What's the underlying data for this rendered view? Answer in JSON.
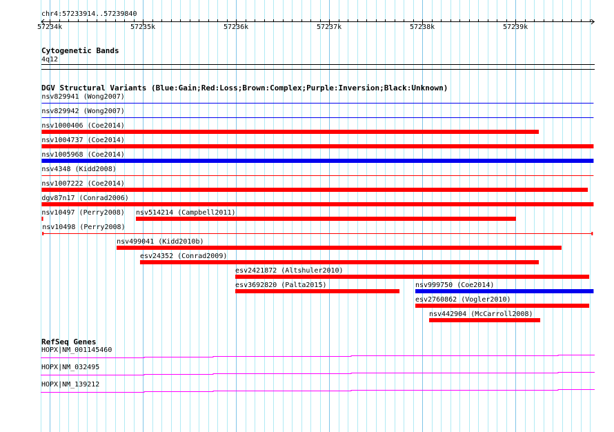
{
  "location": "chr4:57233914..57239840",
  "view": {
    "start": 57233914,
    "end": 57239840
  },
  "ruler": {
    "ticks": [
      "57234k",
      "57235k",
      "57236k",
      "57237k",
      "57238k",
      "57239k"
    ],
    "tick_values": [
      57234000,
      57235000,
      57236000,
      57237000,
      57238000,
      57239000
    ]
  },
  "cyto": {
    "title": "Cytogenetic Bands",
    "band": "4q12"
  },
  "dgv": {
    "title": "DGV Structural Variants (Blue:Gain;Red:Loss;Brown:Complex;Purple:Inversion;Black:Unknown)",
    "colors": {
      "gain": "#0000ee",
      "loss": "#ff0000"
    },
    "rows": [
      [
        {
          "label": "nsv829941 (Wong2007)",
          "start": 57233914,
          "end": 57239840,
          "type": "gain",
          "thin": true
        }
      ],
      [
        {
          "label": "nsv829942 (Wong2007)",
          "start": 57233914,
          "end": 57239840,
          "type": "gain",
          "thin": true
        }
      ],
      [
        {
          "label": "nsv1000406 (Coe2014)",
          "start": 57233914,
          "end": 57239252,
          "type": "loss"
        }
      ],
      [
        {
          "label": "nsv1004737 (Coe2014)",
          "start": 57233914,
          "end": 57239840,
          "type": "loss"
        }
      ],
      [
        {
          "label": "nsv1005968 (Coe2014)",
          "start": 57233914,
          "end": 57239840,
          "type": "gain"
        }
      ],
      [
        {
          "label": "nsv4348 (Kidd2008)",
          "start": 57233914,
          "end": 57239840,
          "type": "loss",
          "thin": true
        }
      ],
      [
        {
          "label": "nsv1007222 (Coe2014)",
          "start": 57233914,
          "end": 57239778,
          "type": "loss"
        }
      ],
      [
        {
          "label": "dgv87n17 (Conrad2006)",
          "start": 57233914,
          "end": 57239840,
          "type": "loss"
        }
      ],
      [
        {
          "label": "nsv10497 (Perry2008)",
          "start": 57233914,
          "end": 57233930,
          "type": "loss"
        },
        {
          "label": "nsv514214 (Campbell2011)",
          "start": 57234926,
          "end": 57239007,
          "type": "loss"
        }
      ],
      [
        {
          "label": "nsv10498 (Perry2008)",
          "start": 57233920,
          "end": 57239832,
          "type": "loss",
          "thin": true,
          "ticks": true
        }
      ],
      [
        {
          "label": "nsv499041 (Kidd2010b)",
          "start": 57234719,
          "end": 57239496,
          "type": "loss"
        }
      ],
      [
        {
          "label": "esv24352 (Conrad2009)",
          "start": 57234970,
          "end": 57239252,
          "type": "loss"
        }
      ],
      [
        {
          "label": "esv2421872 (Altshuler2010)",
          "start": 57235993,
          "end": 57239793,
          "type": "loss"
        }
      ],
      [
        {
          "label": "esv3692820 (Palta2015)",
          "start": 57235993,
          "end": 57237756,
          "type": "loss"
        },
        {
          "label": "nsv999750 (Coe2014)",
          "start": 57237926,
          "end": 57239840,
          "type": "gain"
        }
      ],
      [
        {
          "label": "esv2760862 (Vogler2010)",
          "start": 57237926,
          "end": 57239793,
          "type": "loss"
        }
      ],
      [
        {
          "label": "nsv442904 (McCarroll2008)",
          "start": 57238074,
          "end": 57239267,
          "type": "loss"
        }
      ]
    ]
  },
  "refseq": {
    "title": "RefSeq Genes",
    "color": "#ff00ff",
    "genes": [
      "HOPX|NM_001145460",
      "HOPX|NM_032495",
      "HOPX|NM_139212"
    ]
  }
}
